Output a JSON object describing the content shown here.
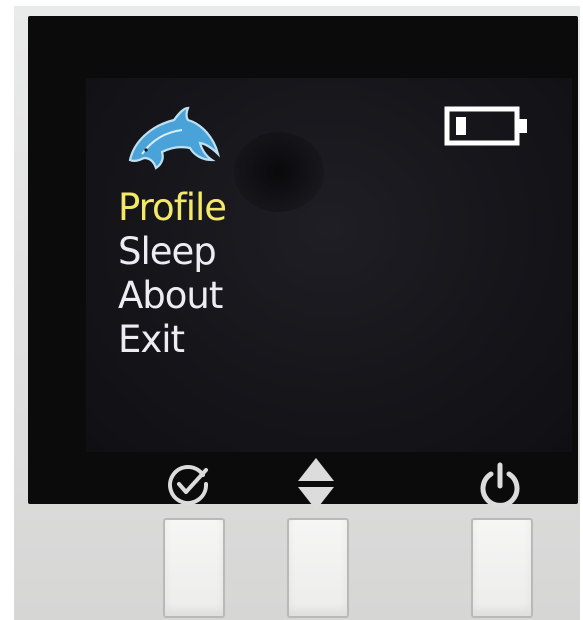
{
  "device": {
    "logo_icon": "dolphin-logo-icon",
    "battery_icon": "battery-low-icon",
    "battery_level": 0.2
  },
  "menu": {
    "items": [
      {
        "label": "Profile",
        "selected": true
      },
      {
        "label": "Sleep",
        "selected": false
      },
      {
        "label": "About",
        "selected": false
      },
      {
        "label": "Exit",
        "selected": false
      }
    ]
  },
  "controls": {
    "confirm_icon": "check-circle-icon",
    "navigate_icon": "up-down-arrows-icon",
    "power_icon": "power-icon"
  },
  "colors": {
    "selected_text": "#f3e968",
    "menu_text": "#ececf2",
    "accent_blue": "#4aa3d8",
    "screen_bg": "#15151a"
  }
}
